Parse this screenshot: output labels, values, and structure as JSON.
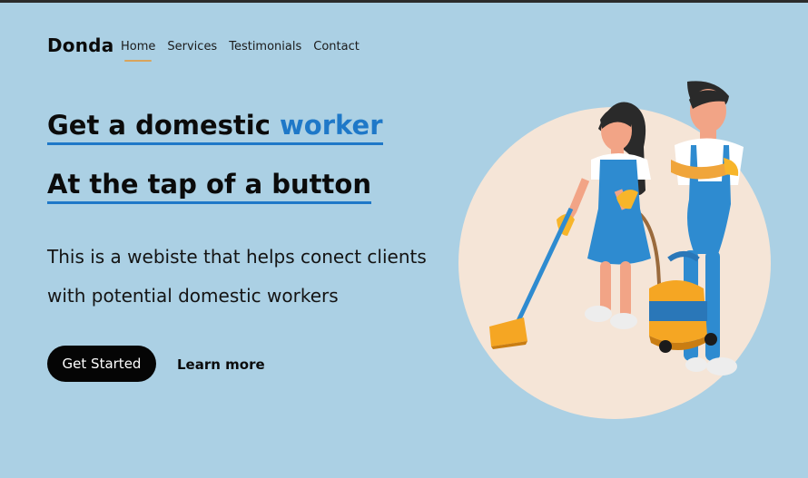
{
  "header": {
    "logo": "Donda",
    "nav": [
      {
        "label": "Home",
        "active": true
      },
      {
        "label": "Services",
        "active": false
      },
      {
        "label": "Testimonials",
        "active": false
      },
      {
        "label": "Contact",
        "active": false
      }
    ]
  },
  "hero": {
    "headline_1_prefix": "Get a domestic ",
    "headline_1_accent": "worker",
    "headline_2": "At the tap of a button",
    "description_line_1": "This is a webiste that helps conect clients",
    "description_line_2": "with potential domestic workers",
    "primary_button": "Get Started",
    "secondary_link": "Learn more"
  },
  "illustration": {
    "icon": "cleaning-workers-illustration",
    "circle_color": "#f5e5d7"
  },
  "colors": {
    "background": "#abd0e4",
    "accent": "#1e78c8",
    "nav_indicator": "#d9a45c",
    "button": "#050505"
  }
}
